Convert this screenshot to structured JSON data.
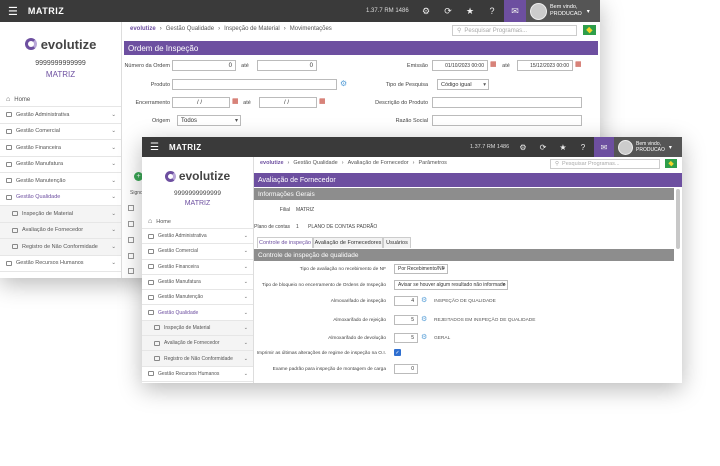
{
  "back": {
    "title": "MATRIZ",
    "version": "1.37.7 RM 1486",
    "user": {
      "greeting": "Bem vindo,",
      "name": "PRODUCAO"
    },
    "logo": "evolutize",
    "company_id": "9999999999999",
    "company": "MATRIZ",
    "home": "Home",
    "nav": [
      "Gestão Administrativa",
      "Gestão Comercial",
      "Gestão Financeira",
      "Gestão Manufatura",
      "Gestão Manutenção",
      "Gestão Qualidade"
    ],
    "sub": [
      "Inspeção de Material",
      "Avaliação de Fornecedor",
      "Registro de Não Conformidade",
      "Gestão Recursos Humanos"
    ],
    "breadcrumb": [
      "Gestão Qualidade",
      "Inspeção de Material",
      "Movimentações"
    ],
    "search_placeholder": "Pesquisar Programas...",
    "page_title": "Ordem de Inspeção",
    "labels": {
      "ordem": "Número da Ordem",
      "ate": "até",
      "produto": "Produto",
      "encerramento": "Encerramento",
      "origem": "Origem",
      "emissao": "Emissão",
      "tipo": "Tipo de Pesquisa",
      "descricao": "Descrição do Produto",
      "razao": "Razão Social"
    },
    "values": {
      "ordem_de": "0",
      "ordem_ate": "0",
      "encerr_de": "/ /",
      "encerr_ate": "/ /",
      "origem": "Todos",
      "emissao_de": "01/10/2023 00:00",
      "emissao_ate": "15/12/2023 00:00",
      "tipo": "Código igual"
    },
    "partial": {
      "sign": "Signo",
      "plus": "+"
    }
  },
  "front": {
    "title": "MATRIZ",
    "version": "1.37.7 RM 1486",
    "user": {
      "greeting": "Bem vindo,",
      "name": "PRODUCAO"
    },
    "logo": "evolutize",
    "company_id": "9999999999999",
    "company": "MATRIZ",
    "home": "Home",
    "nav": [
      "Gestão Administrativa",
      "Gestão Comercial",
      "Gestão Financeira",
      "Gestão Manufatura",
      "Gestão Manutenção",
      "Gestão Qualidade"
    ],
    "sub": [
      "Inspeção de Material",
      "Avaliação de Fornecedor",
      "Registro de Não Conformidade",
      "Gestão Recursos Humanos"
    ],
    "breadcrumb": [
      "Gestão Qualidade",
      "Avaliação de Fornecedor",
      "Parâmetros"
    ],
    "search_placeholder": "Pesquisar Programas...",
    "page_title": "Avaliação de Fornecedor",
    "info_title": "Informações Gerais",
    "filial_label": "Filial",
    "filial_value": "MATRIZ",
    "plano_label": "Plano de contas",
    "plano_code": "1",
    "plano_value": "PLANO DE CONTAS PADRÃO",
    "tabs": [
      "Controle de inspeção",
      "Avaliação de Fornecedores",
      "Usuários"
    ],
    "section": "Controle de inspeção de qualidade",
    "rows": {
      "tipo_aval_label": "Tipo de avaliação no recebimento de NF",
      "tipo_aval_value": "Por Recebimento/NF",
      "tipo_bloq_label": "Tipo de bloqueio no encerramento de Ordens de Inspeção",
      "tipo_bloq_value": "Avisar se houver algum resultado não informado",
      "alm_insp_label": "Almoxarifado de inspeção",
      "alm_insp_value": "4",
      "alm_insp_desc": "INSPEÇÃO DE QUALIDADE",
      "alm_rej_label": "Almoxarifado de rejeição",
      "alm_rej_value": "5",
      "alm_rej_desc": "REJEITADOS EM INSPEÇÃO DE QUALIDADE",
      "alm_dev_label": "Almoxarifado de devolução",
      "alm_dev_value": "5",
      "alm_dev_desc": "GERAL",
      "imprimir_label": "Imprimir as últimas alterações de regime de inspeção na O.I.",
      "exame_label": "Exame padrão para inspeção de montagem de carga",
      "exame_value": "0"
    }
  }
}
